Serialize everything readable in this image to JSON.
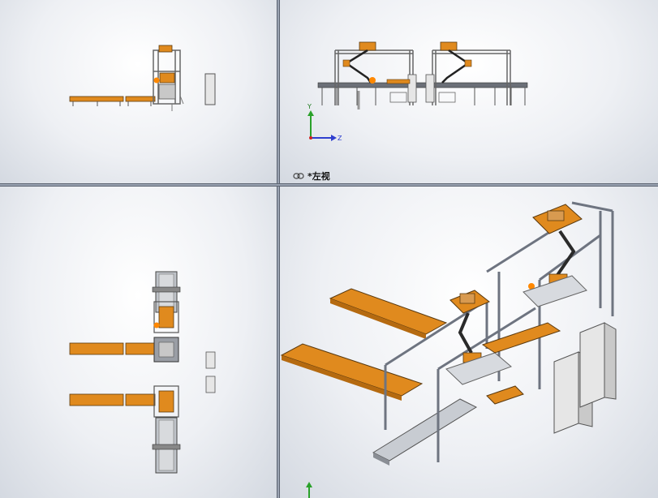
{
  "viewports": {
    "top_right": {
      "view_label": "*左视"
    },
    "bottom_right": {}
  },
  "triad": {
    "y_label": "Y",
    "z_label": "Z"
  },
  "colors": {
    "accent_orange": "#e08a1e",
    "frame_gray": "#7a808a",
    "cabinet": "#e6e6e6",
    "y_axis": "#2aa12a",
    "z_axis": "#2f3fcf"
  }
}
